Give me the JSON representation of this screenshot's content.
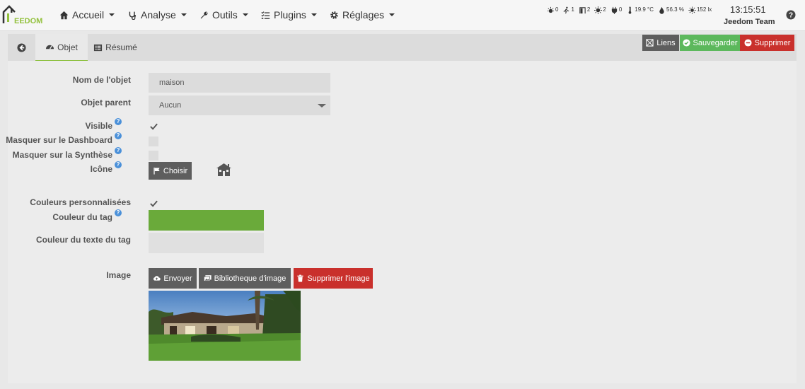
{
  "nav": {
    "logo_text": "EEDOM",
    "items": [
      {
        "label": "Accueil",
        "icon": "home-icon"
      },
      {
        "label": "Analyse",
        "icon": "stethoscope-icon"
      },
      {
        "label": "Outils",
        "icon": "wrench-icon"
      },
      {
        "label": "Plugins",
        "icon": "tasks-icon"
      },
      {
        "label": "Réglages",
        "icon": "cog-icon"
      }
    ],
    "summary": [
      {
        "icon": "light-icon",
        "value": "0"
      },
      {
        "icon": "motion-icon",
        "value": "1"
      },
      {
        "icon": "door-icon",
        "value": "2"
      },
      {
        "icon": "socket-icon",
        "value": "2"
      },
      {
        "icon": "plug-icon",
        "value": "0"
      },
      {
        "icon": "thermometer-icon",
        "value": "19.9 °C"
      },
      {
        "icon": "humidity-icon",
        "value": "56.3 %"
      },
      {
        "icon": "luminosity-icon",
        "value": "152 lx"
      }
    ],
    "clock": "13:15:51",
    "user": "Jeedom Team"
  },
  "tabs": {
    "objet": "Objet",
    "resume": "Résumé"
  },
  "actions": {
    "liens": "Liens",
    "sauvegarder": "Sauvegarder",
    "supprimer": "Supprimer"
  },
  "form": {
    "nom_label": "Nom de l'objet",
    "nom_value": "maison",
    "parent_label": "Objet parent",
    "parent_value": "Aucun",
    "visible_label": "Visible",
    "visible_checked": true,
    "masquer_dashboard_label": "Masquer sur le Dashboard",
    "masquer_synthese_label": "Masquer sur la Synthèse",
    "icone_label": "Icône",
    "choisir_label": "Choisir",
    "couleurs_label": "Couleurs personnalisées",
    "couleur_tag_label": "Couleur du tag",
    "couleur_tag_value": "#6aaa3a",
    "couleur_texte_label": "Couleur du texte du tag",
    "image_label": "Image",
    "envoyer_label": "Envoyer",
    "bibliotheque_label": "Bibliotheque d'image",
    "supprimer_image_label": "Supprimer l'image"
  }
}
